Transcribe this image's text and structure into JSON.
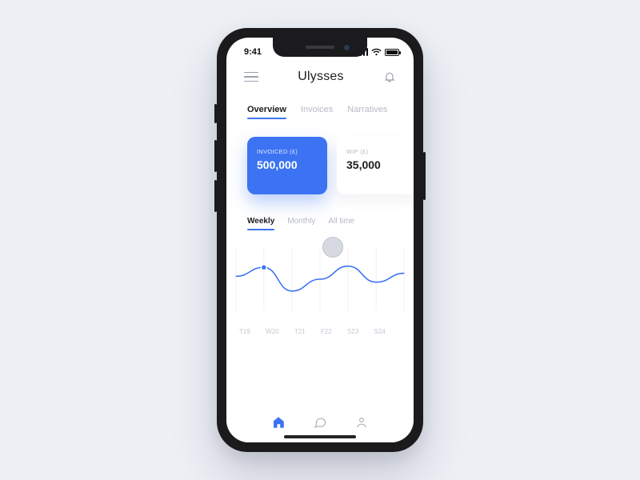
{
  "status": {
    "time": "9:41"
  },
  "header": {
    "title": "Ulysses"
  },
  "tabs": [
    {
      "label": "Overview",
      "active": true
    },
    {
      "label": "Invoices",
      "active": false
    },
    {
      "label": "Narratives",
      "active": false
    }
  ],
  "cards": [
    {
      "label": "INVOICED (£)",
      "value": "500,000",
      "variant": "primary"
    },
    {
      "label": "WIP (£)",
      "value": "35,000",
      "variant": "default"
    }
  ],
  "period_tabs": [
    {
      "label": "Weekly",
      "active": true
    },
    {
      "label": "Monthly",
      "active": false
    },
    {
      "label": "All time",
      "active": false
    }
  ],
  "chart_data": {
    "type": "line",
    "title": "",
    "xlabel": "",
    "ylabel": "",
    "categories": [
      "T19",
      "W20",
      "T21",
      "F22",
      "S23",
      "S24",
      ""
    ],
    "values": [
      55,
      70,
      30,
      50,
      72,
      45,
      60
    ],
    "ylim": [
      0,
      100
    ],
    "highlight_index": 1,
    "accent": "#3b73f2"
  },
  "nav": {
    "items": [
      "home",
      "chat",
      "profile"
    ],
    "active": "home"
  }
}
